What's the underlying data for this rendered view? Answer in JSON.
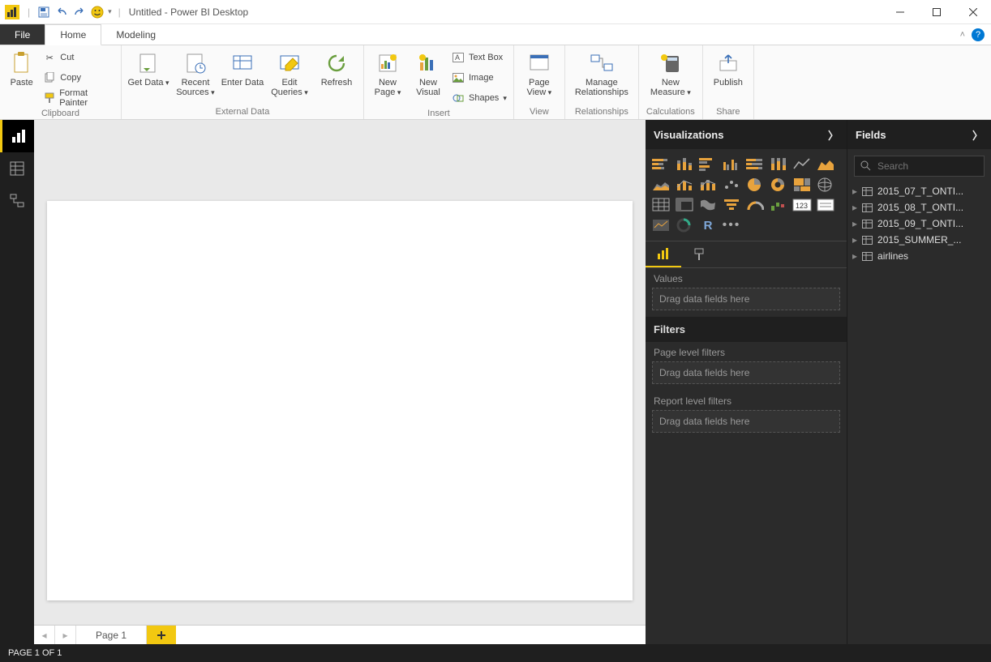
{
  "title": "Untitled - Power BI Desktop",
  "qat": {
    "save": "Save",
    "undo": "Undo",
    "redo": "Redo"
  },
  "tabs": {
    "file": "File",
    "home": "Home",
    "modeling": "Modeling"
  },
  "ribbon": {
    "clipboard": {
      "label": "Clipboard",
      "paste": "Paste",
      "cut": "Cut",
      "copy": "Copy",
      "format_painter": "Format Painter"
    },
    "external": {
      "label": "External Data",
      "get_data": "Get Data",
      "recent": "Recent Sources",
      "enter": "Enter Data",
      "edit": "Edit Queries",
      "refresh": "Refresh"
    },
    "insert": {
      "label": "Insert",
      "new_page": "New Page",
      "new_visual": "New Visual",
      "textbox": "Text Box",
      "image": "Image",
      "shapes": "Shapes"
    },
    "view": {
      "label": "View",
      "page_view": "Page View"
    },
    "rel": {
      "label": "Relationships",
      "manage": "Manage Relationships"
    },
    "calc": {
      "label": "Calculations",
      "measure": "New Measure"
    },
    "share": {
      "label": "Share",
      "publish": "Publish"
    }
  },
  "pages": {
    "page1": "Page 1"
  },
  "viz": {
    "head": "Visualizations",
    "values_label": "Values",
    "drop_hint": "Drag data fields here",
    "filters_head": "Filters",
    "page_filters": "Page level filters",
    "report_filters": "Report level filters"
  },
  "fields": {
    "head": "Fields",
    "search_placeholder": "Search",
    "tables": [
      "2015_07_T_ONTI...",
      "2015_08_T_ONTI...",
      "2015_09_T_ONTI...",
      "2015_SUMMER_...",
      "airlines"
    ]
  },
  "status": "PAGE 1 OF 1"
}
